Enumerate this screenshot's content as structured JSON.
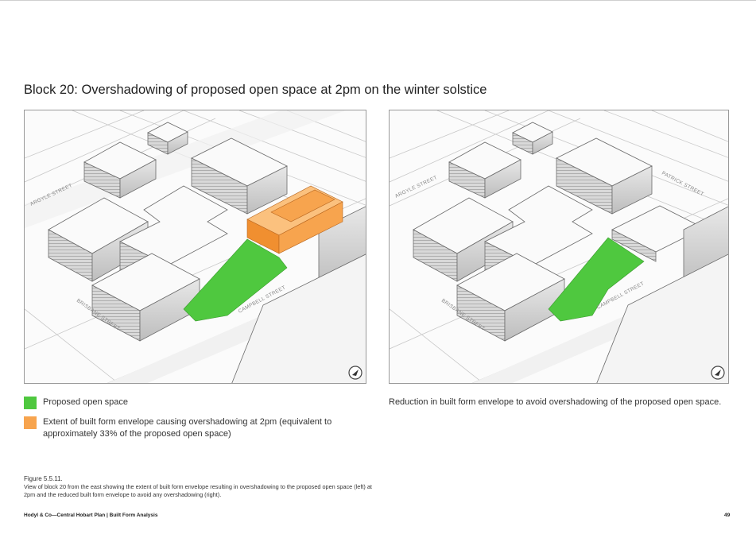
{
  "title": "Block 20: Overshadowing of proposed open space at 2pm on the winter solstice",
  "colors": {
    "open_space": "#4fc83f",
    "overshadow_envelope": "#f7a44e"
  },
  "left_image": {
    "streets": [
      "ARGYLE STREET",
      "BRISBANE STREET",
      "CAMPBELL STREET"
    ]
  },
  "right_image": {
    "streets": [
      "ARGYLE STREET",
      "PATRICK STREET",
      "BRISBANE STREET",
      "CAMPBELL STREET"
    ]
  },
  "legend": [
    {
      "color": "#4fc83f",
      "label": "Proposed open space"
    },
    {
      "color": "#f7a44e",
      "label": "Extent of built form envelope causing overshadowing at 2pm (equivalent to approximately 33% of the proposed open space)"
    }
  ],
  "right_caption": "Reduction in built form envelope to avoid overshadowing of the proposed open space.",
  "figure": {
    "number": "Figure 5.5.11.",
    "description": "View of block 20 from the east showing the extent of built form envelope resulting in overshadowing to the proposed open space (left) at 2pm and the reduced built form envelope to avoid any overshadowing (right)."
  },
  "footer": {
    "text": "Hodyl & Co—Central Hobart Plan | Built Form Analysis",
    "page": "49"
  },
  "icons": {
    "north_arrow": "north-arrow-icon"
  }
}
